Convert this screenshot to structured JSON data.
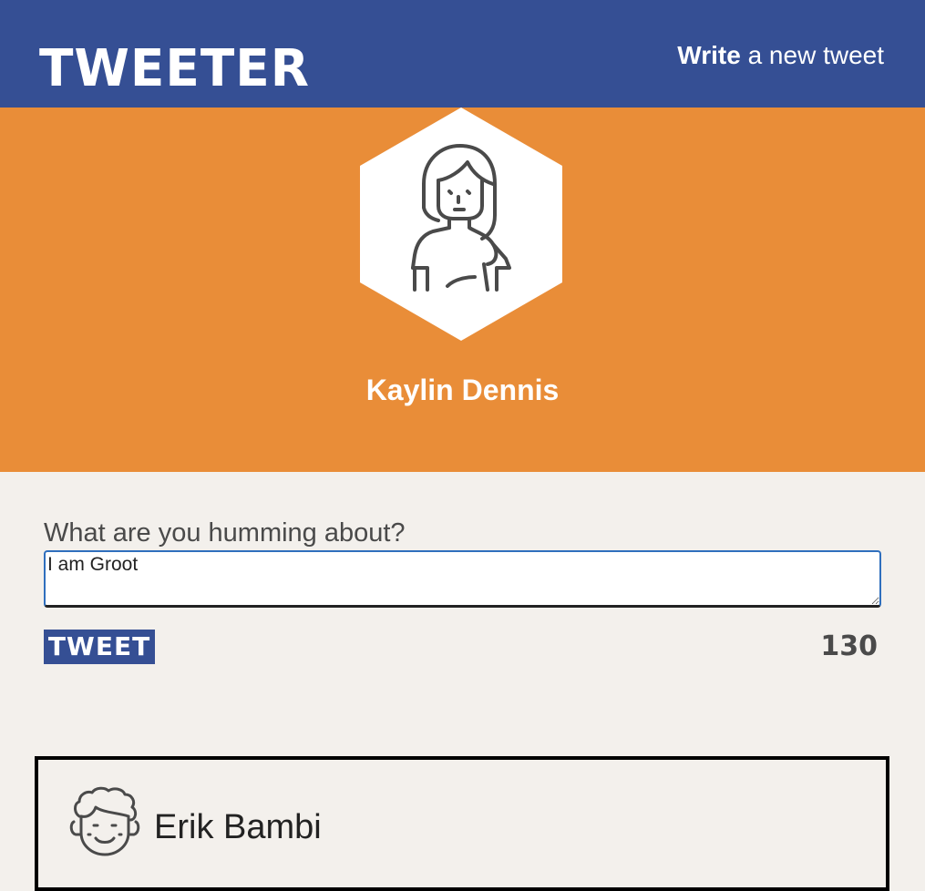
{
  "nav": {
    "brand": "TWEETER",
    "compose_bold": "Write",
    "compose_rest": " a new tweet"
  },
  "profile": {
    "avatar_icon": "woman-avatar-icon",
    "name": "Kaylin Dennis",
    "background_color": "#e98d38"
  },
  "composer": {
    "label": "What are you humming about?",
    "value": "I am Groot",
    "button_label": "TWEET",
    "char_counter": "130"
  },
  "tweets": [
    {
      "avatar_icon": "man-curly-hair-avatar-icon",
      "author": "Erik Bambi"
    }
  ],
  "colors": {
    "nav": "#354f94",
    "profile": "#e98d38",
    "page": "#f3f0ec"
  }
}
